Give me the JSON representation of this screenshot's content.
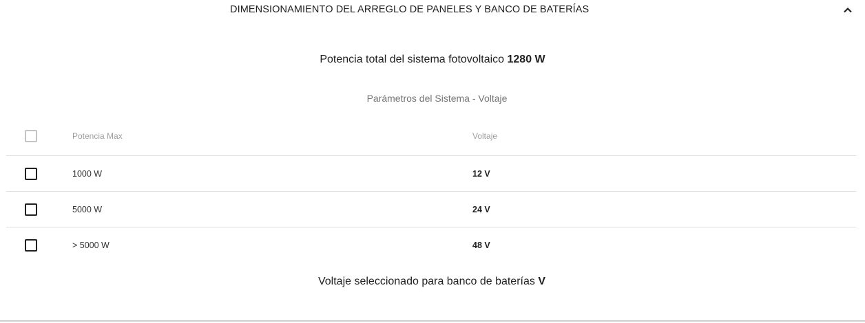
{
  "panel": {
    "title": "DIMENSIONAMIENTO DEL ARREGLO DE PANELES Y BANCO DE BATERÍAS",
    "toggle_icon": "chevron-up-icon"
  },
  "summary": {
    "total_label": "Potencia total del sistema fotovoltaico",
    "total_value": "1280 W"
  },
  "table": {
    "caption": "Parámetros del Sistema - Voltaje",
    "headers": {
      "power": "Potencia Max",
      "voltage": "Voltaje"
    },
    "rows": [
      {
        "power": "1000 W",
        "voltage": "12 V",
        "checked": false
      },
      {
        "power": "5000 W",
        "voltage": "24 V",
        "checked": false
      },
      {
        "power": "> 5000 W",
        "voltage": "48 V",
        "checked": false
      }
    ]
  },
  "selection": {
    "label": "Voltaje seleccionado para banco de baterías",
    "value": "V"
  }
}
